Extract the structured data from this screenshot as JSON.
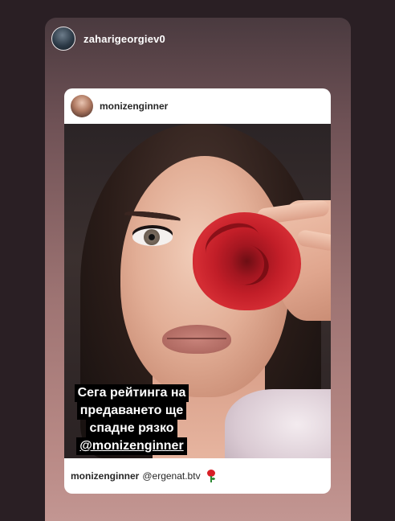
{
  "story": {
    "username": "zaharigeorgiev0"
  },
  "shared_post": {
    "username": "monizenginner",
    "caption_lines": [
      "Сега рейтинга на",
      "предаването ще",
      "спадне рязко",
      "@monizenginner"
    ],
    "footer": {
      "username": "monizenginner",
      "mention": "@ergenat.btv",
      "emoji_icon": "rose-icon"
    }
  },
  "colors": {
    "caption_bg": "#000000",
    "caption_text": "#ffffff",
    "card_bg": "#ffffff",
    "rose_red": "#c21e28"
  }
}
